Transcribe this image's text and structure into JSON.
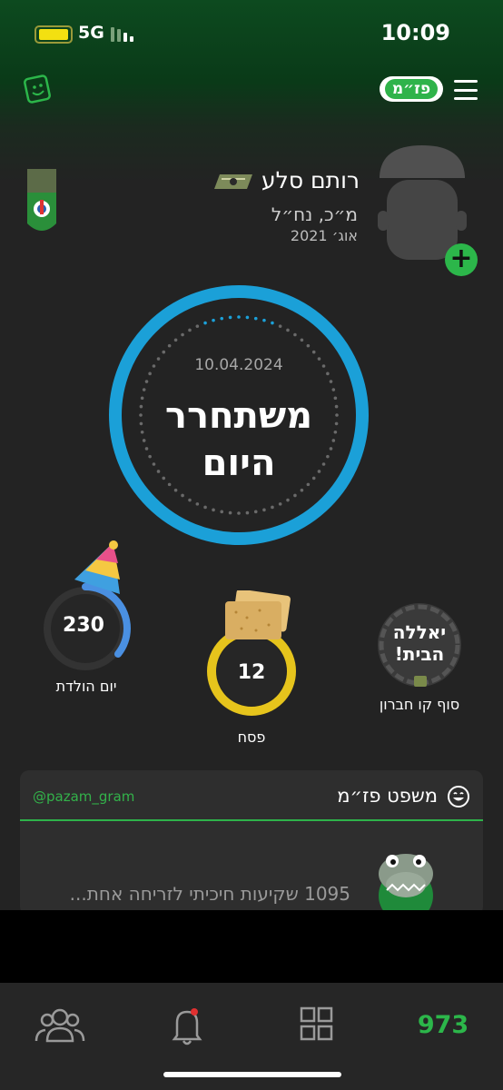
{
  "status_bar": {
    "network": "5G",
    "time": "10:09"
  },
  "header": {
    "logo_text": "פז״מ"
  },
  "profile": {
    "name": "רותם סלע",
    "role": "מ״כ, נח״ל",
    "enlisted": "אוג׳ 2021",
    "add_label": "+"
  },
  "release": {
    "date": "10.04.2024",
    "line1": "משתחרר",
    "line2": "היום"
  },
  "counters": [
    {
      "value": "230",
      "label": "יום הולדת",
      "progress": 0.5
    },
    {
      "value": "12",
      "label": "פסח"
    },
    {
      "value": "יאללה הבית!",
      "label": "סוף קו חברון"
    }
  ],
  "card": {
    "title": "משפט פז״מ",
    "handle": "@pazam_gram",
    "text": "1095 שקיעות חיכיתי לזריחה אחת..."
  },
  "tabbar": {
    "code": "973"
  },
  "colors": {
    "accent": "#2cb64a",
    "ring": "#1ba0d8",
    "yellow": "#e6c41c"
  }
}
